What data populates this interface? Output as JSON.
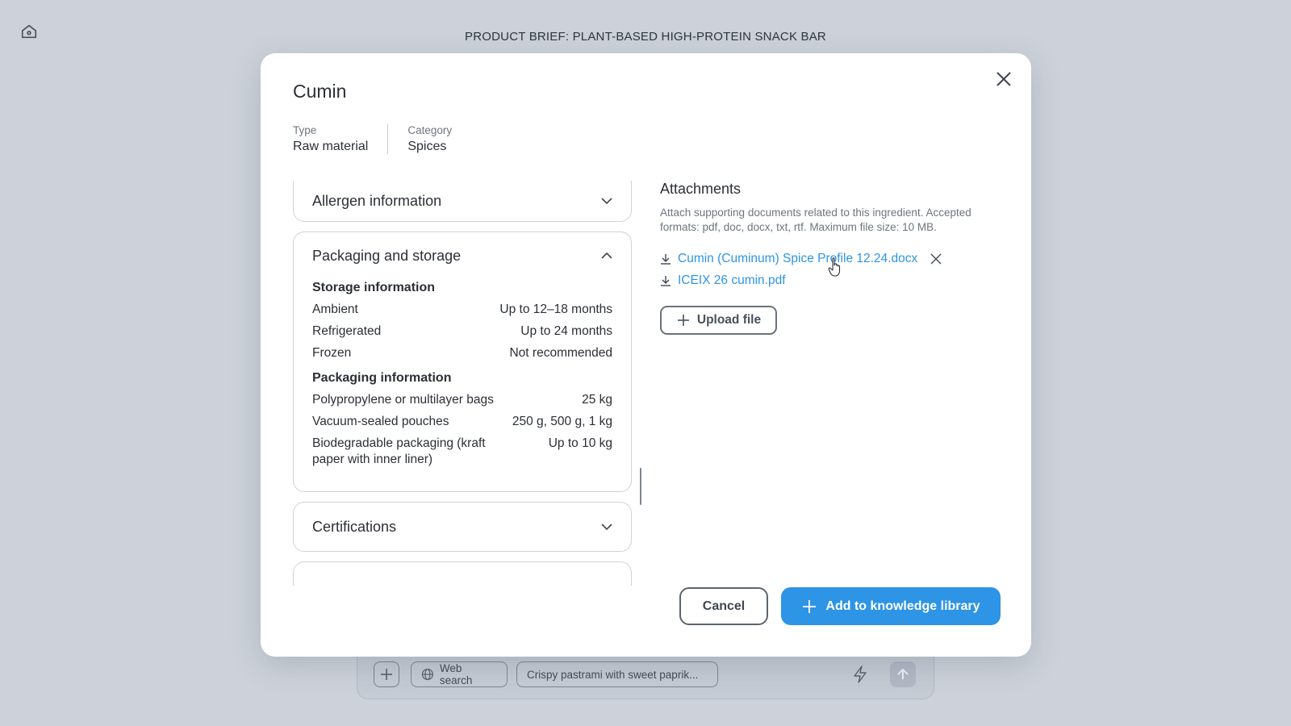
{
  "page": {
    "title": "PRODUCT BRIEF: PLANT-BASED HIGH-PROTEIN SNACK BAR",
    "home_icon": "home-icon"
  },
  "composer": {
    "web_search_label": "Web search",
    "prompt_chip_label": "Crispy pastrami with sweet paprik..."
  },
  "modal": {
    "title": "Cumin",
    "meta": {
      "type_label": "Type",
      "type_value": "Raw material",
      "category_label": "Category",
      "category_value": "Spices"
    },
    "sections": {
      "allergen": "Allergen information",
      "packaging": "Packaging and storage",
      "certifications": "Certifications"
    },
    "storage": {
      "heading": "Storage information",
      "rows": [
        {
          "k": "Ambient",
          "v": "Up to 12–18 months"
        },
        {
          "k": "Refrigerated",
          "v": "Up to 24 months"
        },
        {
          "k": "Frozen",
          "v": "Not recommended"
        }
      ]
    },
    "packaging": {
      "heading": "Packaging information",
      "rows": [
        {
          "k": "Polypropylene or multilayer bags",
          "v": "25 kg"
        },
        {
          "k": "Vacuum-sealed pouches",
          "v": "250 g, 500 g, 1 kg"
        },
        {
          "k": "Biodegradable packaging (kraft paper with inner liner)",
          "v": "Up to 10 kg"
        }
      ]
    },
    "attachments": {
      "title": "Attachments",
      "description": "Attach supporting documents related to this ingredient. Accepted formats: pdf, doc, docx, txt, rtf. Maximum file size: 10 MB.",
      "files": [
        "Cumin (Cuminum) Spice Profile 12.24.docx",
        "ICEIX 26 cumin.pdf"
      ],
      "upload_label": "Upload file"
    },
    "buttons": {
      "cancel": "Cancel",
      "add": "Add to knowledge library"
    }
  },
  "colors": {
    "accent": "#2d94e6",
    "backdrop": "#cdd2da"
  }
}
